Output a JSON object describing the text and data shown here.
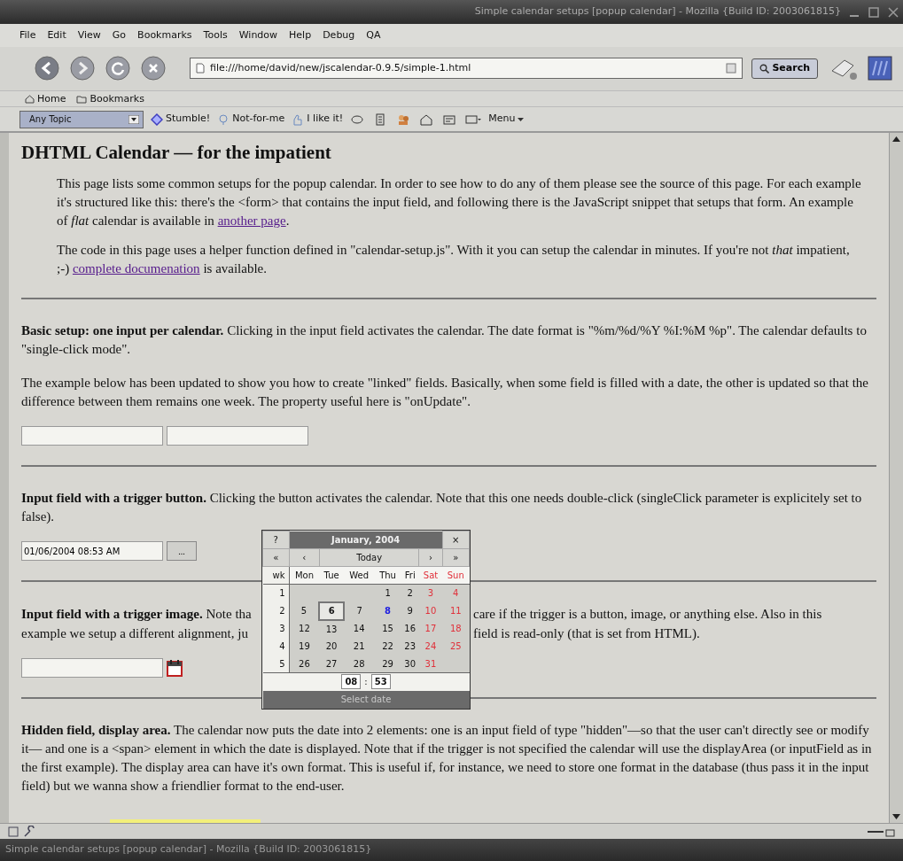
{
  "window": {
    "title": "Simple calendar setups [popup calendar] - Mozilla {Build ID: 2003061815}"
  },
  "menu": [
    "File",
    "Edit",
    "View",
    "Go",
    "Bookmarks",
    "Tools",
    "Window",
    "Help",
    "Debug",
    "QA"
  ],
  "toolbar": {
    "url": "file:///home/david/new/jscalendar-0.9.5/simple-1.html",
    "search": "Search"
  },
  "personal_bar": [
    {
      "kind": "home",
      "label": "Home"
    },
    {
      "kind": "folder",
      "label": "Bookmarks"
    }
  ],
  "stumble_bar": {
    "topic": "Any Topic",
    "items": [
      {
        "kind": "stumble",
        "label": "Stumble!"
      },
      {
        "kind": "down",
        "label": "Not-for-me"
      },
      {
        "kind": "up",
        "label": "I like it!"
      }
    ],
    "menu": "Menu"
  },
  "page": {
    "heading": "DHTML Calendar — for the impatient",
    "intro": [
      {
        "parts": [
          {
            "kind": "text",
            "text": "This page lists some common setups for the popup calendar. In order to see how to do any of them please see the source of this page. For each example it's structured like this: there's the <form> that contains the input field, and following there is the JavaScript snippet that setups that form. An example of *flat* calendar is available in "
          },
          {
            "kind": "link",
            "text": "another page"
          },
          {
            "kind": "text",
            "text": "."
          }
        ]
      },
      {
        "parts": [
          {
            "kind": "text",
            "text": "The code in this page uses a helper function defined in \"calendar-setup.js\". With it you can setup the calendar in minutes. If you're not *that* impatient, ;-) "
          },
          {
            "kind": "link",
            "text": "complete documenation"
          },
          {
            "kind": "text",
            "text": " is available."
          }
        ]
      }
    ],
    "sections": [
      {
        "paragraphs": [
          "**Basic setup: one input per calendar.** Clicking in the input field activates the calendar. The date format is \"%m/%d/%Y %I:%M %p\". The calendar defaults to \"single-click mode\".",
          "The example below has been updated to show you how to create \"linked\" fields. Basically, when some field is filled with a date, the other is updated so that the difference between them remains one week. The property useful here is \"onUpdate\"."
        ],
        "fields": [
          {
            "kind": "input"
          },
          {
            "kind": "input"
          }
        ]
      },
      {
        "paragraphs": [
          "**Input field with a trigger button.** Clicking the button activates the calendar. Note that this one needs double-click (singleClick parameter is explicitely set to false)."
        ],
        "fields": [
          {
            "kind": "input",
            "value": "01/06/2004 08:53 AM"
          },
          {
            "kind": "button",
            "label": "..."
          }
        ]
      },
      {
        "split": {
          "left": [
            "**Input field with a trigger image.** Note tha",
            "example we setup a different alignment, ju"
          ],
          "right": [
            "care if the trigger is a button, image, or anything else. Also in this",
            "field is read-only (that is set from HTML)."
          ]
        },
        "fields": [
          {
            "kind": "input"
          },
          {
            "kind": "image"
          }
        ]
      },
      {
        "paragraphs": [
          "**Hidden field, display area.** The calendar now puts the date into 2 elements: one is an input field of type \"hidden\"—so that the user can't directly see or modify it— and one is a <span> element in which the date is displayed. Note that if the trigger is not specified the calendar will use the displayArea (or inputField as in the first example). The display area can have it's own format. This is useful if, for instance, we need to store one format in the database (thus pass it in the input field) but we wanna show a friendlier format to the end-user."
        ],
        "fields": [
          {
            "kind": "display"
          }
        ]
      }
    ]
  },
  "calendar": {
    "help": "?",
    "title": "January, 2004",
    "close": "×",
    "nav": [
      "«",
      "‹",
      "Today",
      "›",
      "»"
    ],
    "wk": "wk",
    "weekdays": [
      {
        "text": "Mon",
        "weekend": false
      },
      {
        "text": "Tue",
        "weekend": false
      },
      {
        "text": "Wed",
        "weekend": false
      },
      {
        "text": "Thu",
        "weekend": false
      },
      {
        "text": "Fri",
        "weekend": false
      },
      {
        "text": "Sat",
        "weekend": true
      },
      {
        "text": "Sun",
        "weekend": true
      }
    ],
    "weeks": [
      {
        "number": "1",
        "days": [
          {
            "kind": "blank"
          },
          {
            "kind": "blank"
          },
          {
            "kind": "blank"
          },
          {
            "kind": "day",
            "text": "1",
            "weekend": false,
            "selected": false,
            "today": false
          },
          {
            "kind": "day",
            "text": "2",
            "weekend": false,
            "selected": false,
            "today": false
          },
          {
            "kind": "day",
            "text": "3",
            "weekend": true,
            "selected": false,
            "today": false
          },
          {
            "kind": "day",
            "text": "4",
            "weekend": true,
            "selected": false,
            "today": false
          }
        ]
      },
      {
        "number": "2",
        "days": [
          {
            "kind": "day",
            "text": "5",
            "weekend": false,
            "selected": false,
            "today": false
          },
          {
            "kind": "day",
            "text": "6",
            "weekend": false,
            "selected": true,
            "today": false
          },
          {
            "kind": "day",
            "text": "7",
            "weekend": false,
            "selected": false,
            "today": false
          },
          {
            "kind": "day",
            "text": "8",
            "weekend": false,
            "selected": false,
            "today": true
          },
          {
            "kind": "day",
            "text": "9",
            "weekend": false,
            "selected": false,
            "today": false
          },
          {
            "kind": "day",
            "text": "10",
            "weekend": true,
            "selected": false,
            "today": false
          },
          {
            "kind": "day",
            "text": "11",
            "weekend": true,
            "selected": false,
            "today": false
          }
        ]
      },
      {
        "number": "3",
        "days": [
          {
            "kind": "day",
            "text": "12",
            "weekend": false,
            "selected": false,
            "today": false
          },
          {
            "kind": "day",
            "text": "13",
            "weekend": false,
            "selected": false,
            "today": false
          },
          {
            "kind": "day",
            "text": "14",
            "weekend": false,
            "selected": false,
            "today": false
          },
          {
            "kind": "day",
            "text": "15",
            "weekend": false,
            "selected": false,
            "today": false
          },
          {
            "kind": "day",
            "text": "16",
            "weekend": false,
            "selected": false,
            "today": false
          },
          {
            "kind": "day",
            "text": "17",
            "weekend": true,
            "selected": false,
            "today": false
          },
          {
            "kind": "day",
            "text": "18",
            "weekend": true,
            "selected": false,
            "today": false
          }
        ]
      },
      {
        "number": "4",
        "days": [
          {
            "kind": "day",
            "text": "19",
            "weekend": false,
            "selected": false,
            "today": false
          },
          {
            "kind": "day",
            "text": "20",
            "weekend": false,
            "selected": false,
            "today": false
          },
          {
            "kind": "day",
            "text": "21",
            "weekend": false,
            "selected": false,
            "today": false
          },
          {
            "kind": "day",
            "text": "22",
            "weekend": false,
            "selected": false,
            "today": false
          },
          {
            "kind": "day",
            "text": "23",
            "weekend": false,
            "selected": false,
            "today": false
          },
          {
            "kind": "day",
            "text": "24",
            "weekend": true,
            "selected": false,
            "today": false
          },
          {
            "kind": "day",
            "text": "25",
            "weekend": true,
            "selected": false,
            "today": false
          }
        ]
      },
      {
        "number": "5",
        "days": [
          {
            "kind": "day",
            "text": "26",
            "weekend": false,
            "selected": false,
            "today": false
          },
          {
            "kind": "day",
            "text": "27",
            "weekend": false,
            "selected": false,
            "today": false
          },
          {
            "kind": "day",
            "text": "28",
            "weekend": false,
            "selected": false,
            "today": false
          },
          {
            "kind": "day",
            "text": "29",
            "weekend": false,
            "selected": false,
            "today": false
          },
          {
            "kind": "day",
            "text": "30",
            "weekend": false,
            "selected": false,
            "today": false
          },
          {
            "kind": "day",
            "text": "31",
            "weekend": true,
            "selected": false,
            "today": false
          },
          {
            "kind": "blank"
          }
        ]
      }
    ],
    "time": {
      "hours": "08",
      "separator": ":",
      "minutes": "53"
    },
    "footer": "Select date"
  },
  "taskbar": {
    "title": "Simple calendar setups [popup calendar] - Mozilla {Build ID: 2003061815}"
  }
}
